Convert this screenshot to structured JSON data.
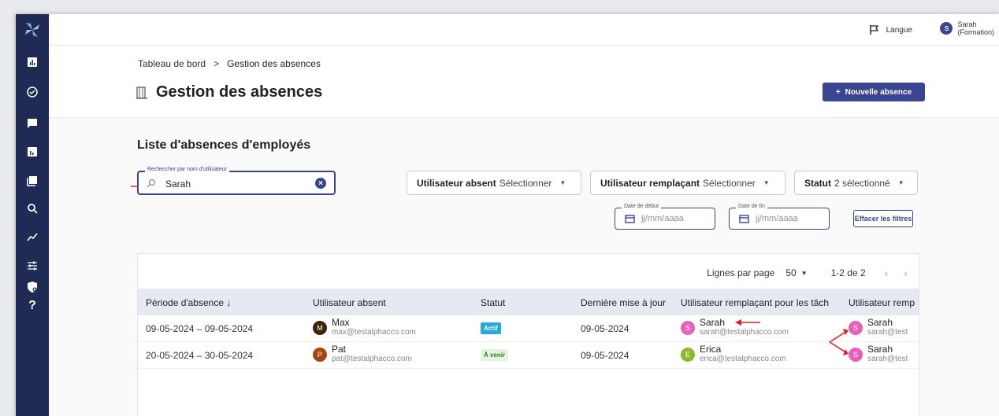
{
  "topbar": {
    "language_label": "Langue",
    "user_initial": "S",
    "user_name_line1": "Sarah",
    "user_name_line2": "(Formation)"
  },
  "breadcrumb": {
    "home": "Tableau de bord",
    "separator": ">",
    "current": "Gestion des absences"
  },
  "page": {
    "title": "Gestion des absences",
    "new_button": "Nouvelle absence",
    "new_button_icon": "+"
  },
  "list": {
    "title": "Liste d'absences d'employés"
  },
  "search": {
    "legend": "Rechercher par nom d'utilisateur",
    "value": "Sarah"
  },
  "filters": {
    "absent_user": {
      "label": "Utilisateur absent",
      "value": "Sélectionner"
    },
    "replacement_user": {
      "label": "Utilisateur remplaçant",
      "value": "Sélectionner"
    },
    "status": {
      "label": "Statut",
      "value": "2 sélectionné"
    },
    "start_date": {
      "legend": "Date de début",
      "placeholder": "jj/mm/aaaa"
    },
    "end_date": {
      "legend": "Date de fin",
      "placeholder": "jj/mm/aaaa"
    },
    "clear_button": "Effacer les filtres"
  },
  "pagination": {
    "rows_per_page_label": "Lignes par page",
    "rows_per_page_value": "50",
    "range": "1-2 de 2"
  },
  "table": {
    "headers": [
      "Période d'absence ↓",
      "Utilisateur absent",
      "Statut",
      "Dernière mise à jour",
      "Utilisateur remplaçant pour les tâch",
      "Utilisateur remp"
    ],
    "rows": [
      {
        "period": "09-05-2024 – 09-05-2024",
        "absent": {
          "initial": "M",
          "name": "Max",
          "email": "max@testalphacco.com"
        },
        "status": "Actif",
        "updated": "09-05-2024",
        "replacement_tasks": {
          "initial": "S",
          "name": "Sarah",
          "email": "sarah@testalphacco.com"
        },
        "replacement_other": {
          "initial": "S",
          "name": "Sarah",
          "email": "sarah@test"
        }
      },
      {
        "period": "20-05-2024 – 30-05-2024",
        "absent": {
          "initial": "P",
          "name": "Pat",
          "email": "pat@testalphacco.com"
        },
        "status": "À venir",
        "updated": "09-05-2024",
        "replacement_tasks": {
          "initial": "E",
          "name": "Erica",
          "email": "erica@testalphacco.com"
        },
        "replacement_other": {
          "initial": "S",
          "name": "Sarah",
          "email": "sarah@test"
        }
      }
    ]
  },
  "colors": {
    "primary": "#3a4591",
    "sidebar": "#1f2b55",
    "active_badge": "#29a9d9",
    "upcoming_badge": "#e3f5dc",
    "annotation_arrow": "#e02020"
  },
  "icons": [
    "logo-icon",
    "dashboard-icon",
    "check-circle-icon",
    "chat-icon",
    "report-icon",
    "book-icon",
    "search-icon",
    "trend-icon",
    "sliders-icon",
    "shield-gear-icon",
    "help-icon",
    "flag-icon",
    "door-icon",
    "calendar-icon",
    "clear-icon"
  ]
}
